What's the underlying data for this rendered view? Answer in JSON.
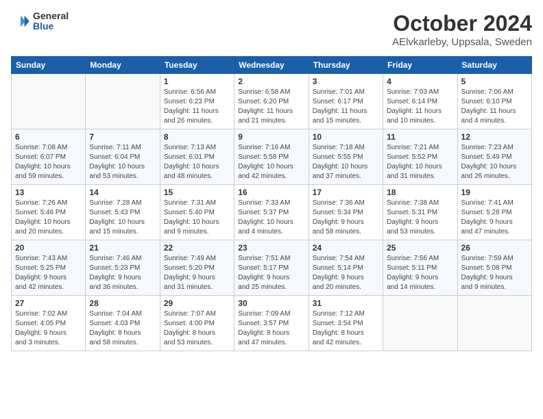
{
  "header": {
    "logo_general": "General",
    "logo_blue": "Blue",
    "title": "October 2024",
    "location": "AElvkarleby, Uppsala, Sweden"
  },
  "calendar": {
    "weekdays": [
      "Sunday",
      "Monday",
      "Tuesday",
      "Wednesday",
      "Thursday",
      "Friday",
      "Saturday"
    ],
    "weeks": [
      [
        {
          "day": "",
          "info": ""
        },
        {
          "day": "",
          "info": ""
        },
        {
          "day": "1",
          "info": "Sunrise: 6:56 AM\nSunset: 6:23 PM\nDaylight: 11 hours\nand 26 minutes."
        },
        {
          "day": "2",
          "info": "Sunrise: 6:58 AM\nSunset: 6:20 PM\nDaylight: 11 hours\nand 21 minutes."
        },
        {
          "day": "3",
          "info": "Sunrise: 7:01 AM\nSunset: 6:17 PM\nDaylight: 11 hours\nand 15 minutes."
        },
        {
          "day": "4",
          "info": "Sunrise: 7:03 AM\nSunset: 6:14 PM\nDaylight: 11 hours\nand 10 minutes."
        },
        {
          "day": "5",
          "info": "Sunrise: 7:06 AM\nSunset: 6:10 PM\nDaylight: 11 hours\nand 4 minutes."
        }
      ],
      [
        {
          "day": "6",
          "info": "Sunrise: 7:08 AM\nSunset: 6:07 PM\nDaylight: 10 hours\nand 59 minutes."
        },
        {
          "day": "7",
          "info": "Sunrise: 7:11 AM\nSunset: 6:04 PM\nDaylight: 10 hours\nand 53 minutes."
        },
        {
          "day": "8",
          "info": "Sunrise: 7:13 AM\nSunset: 6:01 PM\nDaylight: 10 hours\nand 48 minutes."
        },
        {
          "day": "9",
          "info": "Sunrise: 7:16 AM\nSunset: 5:58 PM\nDaylight: 10 hours\nand 42 minutes."
        },
        {
          "day": "10",
          "info": "Sunrise: 7:18 AM\nSunset: 5:55 PM\nDaylight: 10 hours\nand 37 minutes."
        },
        {
          "day": "11",
          "info": "Sunrise: 7:21 AM\nSunset: 5:52 PM\nDaylight: 10 hours\nand 31 minutes."
        },
        {
          "day": "12",
          "info": "Sunrise: 7:23 AM\nSunset: 5:49 PM\nDaylight: 10 hours\nand 26 minutes."
        }
      ],
      [
        {
          "day": "13",
          "info": "Sunrise: 7:26 AM\nSunset: 5:46 PM\nDaylight: 10 hours\nand 20 minutes."
        },
        {
          "day": "14",
          "info": "Sunrise: 7:28 AM\nSunset: 5:43 PM\nDaylight: 10 hours\nand 15 minutes."
        },
        {
          "day": "15",
          "info": "Sunrise: 7:31 AM\nSunset: 5:40 PM\nDaylight: 10 hours\nand 9 minutes."
        },
        {
          "day": "16",
          "info": "Sunrise: 7:33 AM\nSunset: 5:37 PM\nDaylight: 10 hours\nand 4 minutes."
        },
        {
          "day": "17",
          "info": "Sunrise: 7:36 AM\nSunset: 5:34 PM\nDaylight: 9 hours\nand 58 minutes."
        },
        {
          "day": "18",
          "info": "Sunrise: 7:38 AM\nSunset: 5:31 PM\nDaylight: 9 hours\nand 53 minutes."
        },
        {
          "day": "19",
          "info": "Sunrise: 7:41 AM\nSunset: 5:28 PM\nDaylight: 9 hours\nand 47 minutes."
        }
      ],
      [
        {
          "day": "20",
          "info": "Sunrise: 7:43 AM\nSunset: 5:25 PM\nDaylight: 9 hours\nand 42 minutes."
        },
        {
          "day": "21",
          "info": "Sunrise: 7:46 AM\nSunset: 5:23 PM\nDaylight: 9 hours\nand 36 minutes."
        },
        {
          "day": "22",
          "info": "Sunrise: 7:49 AM\nSunset: 5:20 PM\nDaylight: 9 hours\nand 31 minutes."
        },
        {
          "day": "23",
          "info": "Sunrise: 7:51 AM\nSunset: 5:17 PM\nDaylight: 9 hours\nand 25 minutes."
        },
        {
          "day": "24",
          "info": "Sunrise: 7:54 AM\nSunset: 5:14 PM\nDaylight: 9 hours\nand 20 minutes."
        },
        {
          "day": "25",
          "info": "Sunrise: 7:56 AM\nSunset: 5:11 PM\nDaylight: 9 hours\nand 14 minutes."
        },
        {
          "day": "26",
          "info": "Sunrise: 7:59 AM\nSunset: 5:08 PM\nDaylight: 9 hours\nand 9 minutes."
        }
      ],
      [
        {
          "day": "27",
          "info": "Sunrise: 7:02 AM\nSunset: 4:05 PM\nDaylight: 9 hours\nand 3 minutes."
        },
        {
          "day": "28",
          "info": "Sunrise: 7:04 AM\nSunset: 4:03 PM\nDaylight: 8 hours\nand 58 minutes."
        },
        {
          "day": "29",
          "info": "Sunrise: 7:07 AM\nSunset: 4:00 PM\nDaylight: 8 hours\nand 53 minutes."
        },
        {
          "day": "30",
          "info": "Sunrise: 7:09 AM\nSunset: 3:57 PM\nDaylight: 8 hours\nand 47 minutes."
        },
        {
          "day": "31",
          "info": "Sunrise: 7:12 AM\nSunset: 3:54 PM\nDaylight: 8 hours\nand 42 minutes."
        },
        {
          "day": "",
          "info": ""
        },
        {
          "day": "",
          "info": ""
        }
      ]
    ]
  }
}
